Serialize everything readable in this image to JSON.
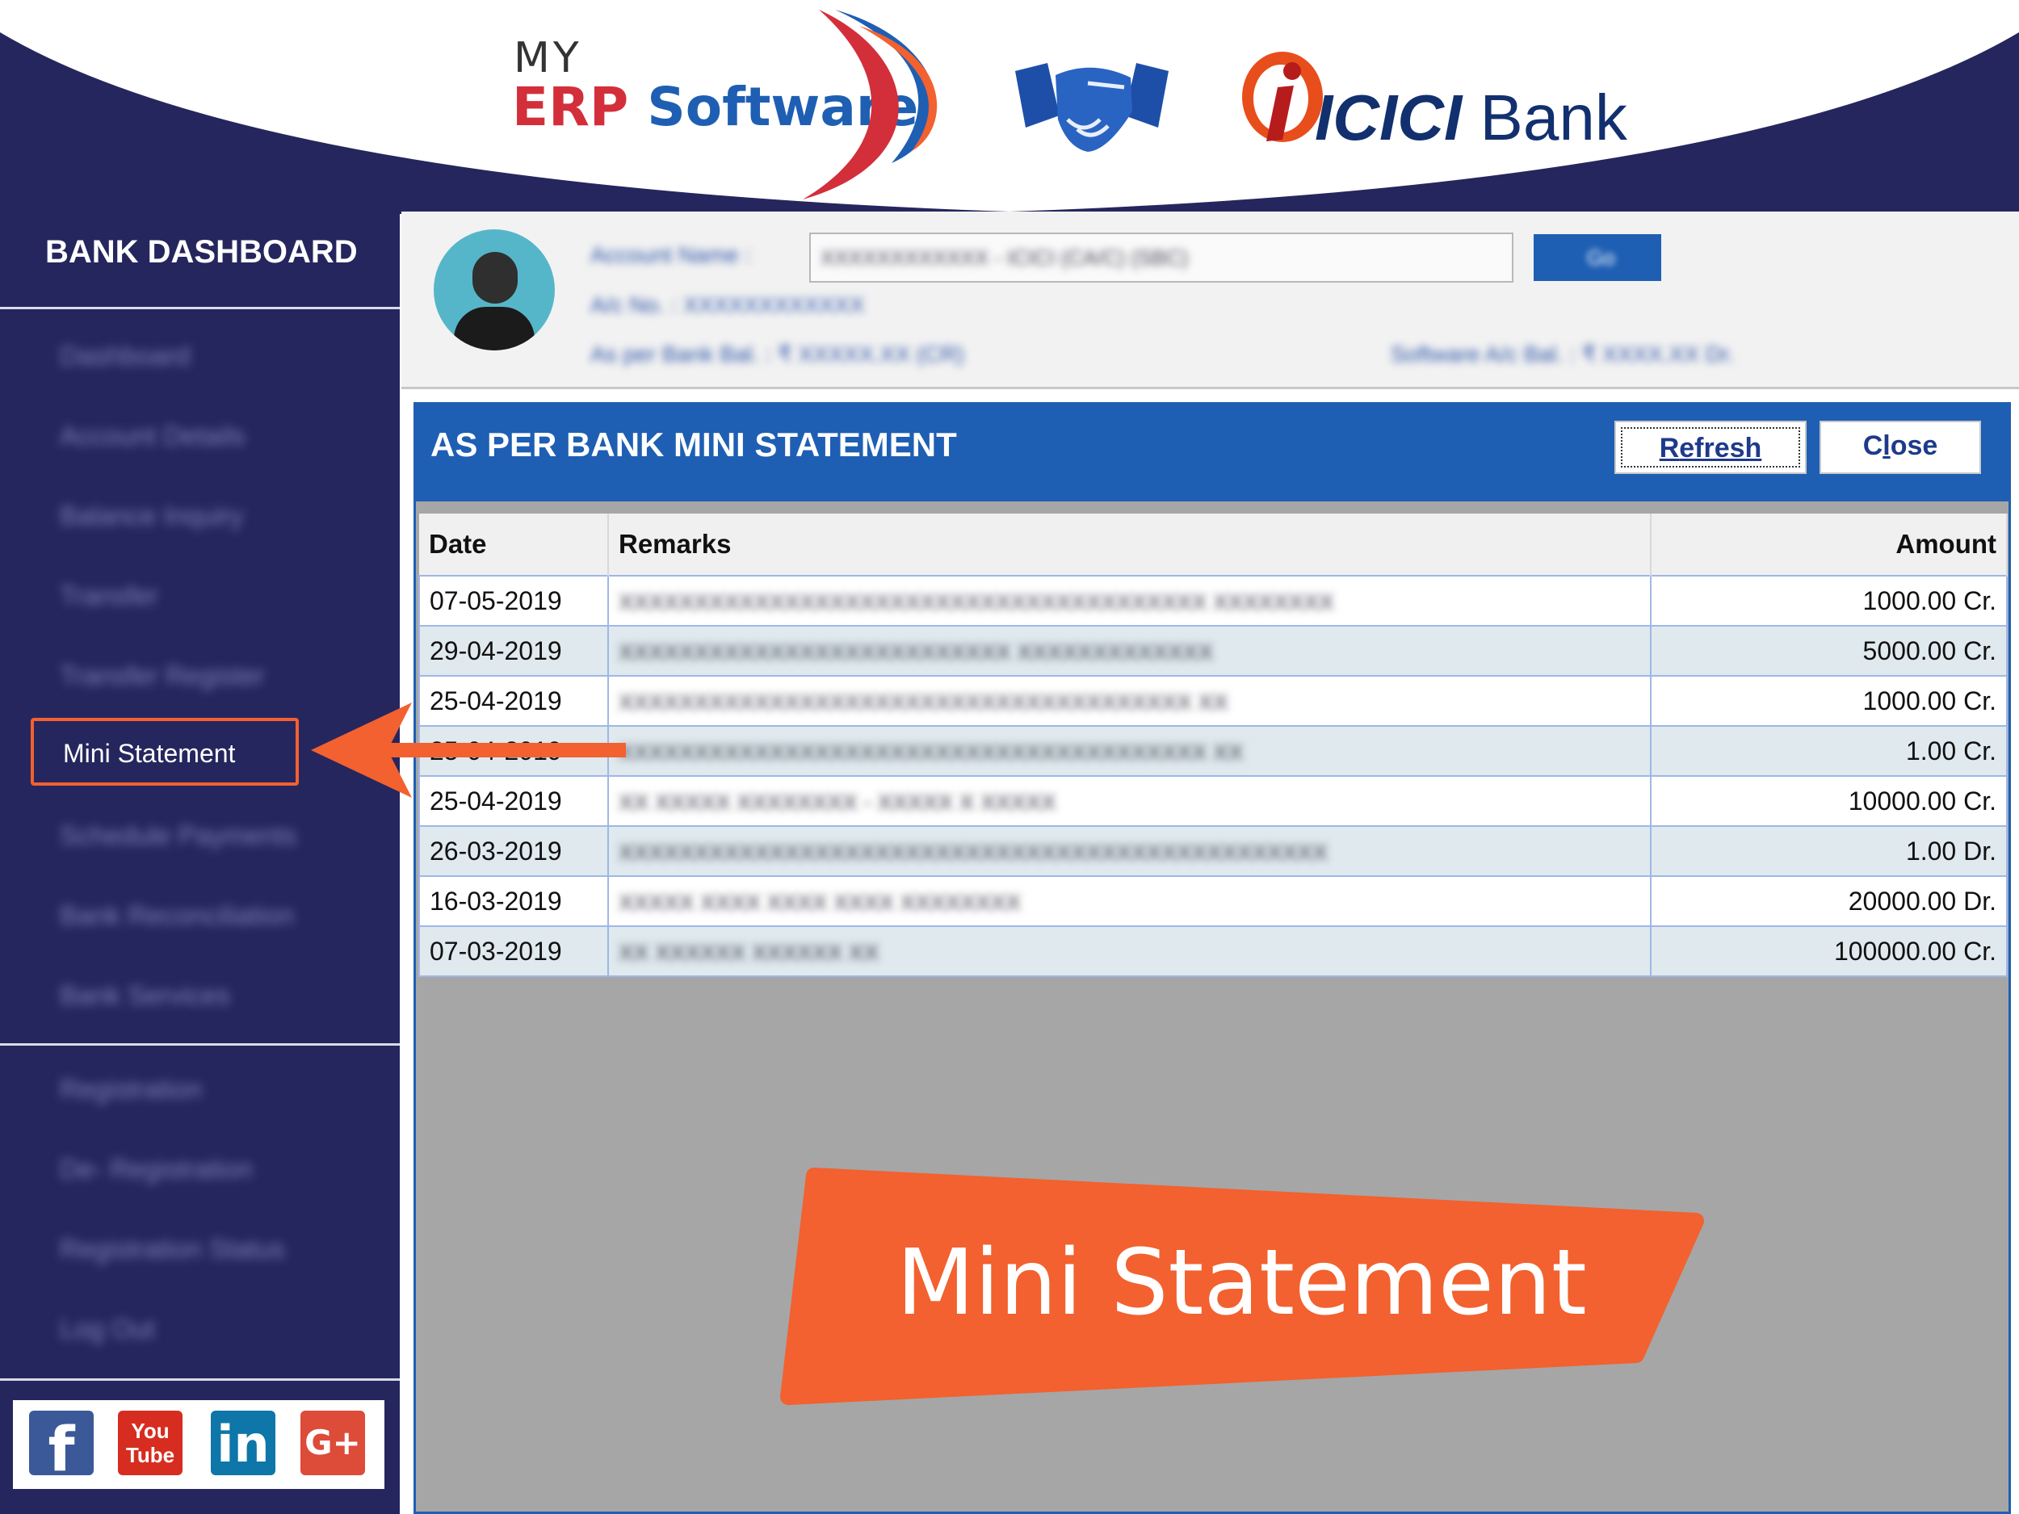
{
  "banner": {
    "erp_logo_my": "MY",
    "erp_logo_erp": "ERP",
    "erp_logo_software": "Software",
    "partner_icon": "handshake-icon",
    "bank_logo_icici": "ICICI",
    "bank_logo_bank": "Bank"
  },
  "sidebar": {
    "title": "BANK DASHBOARD",
    "items": [
      {
        "label": "Dashboard"
      },
      {
        "label": "Account Details"
      },
      {
        "label": "Balance Inquiry"
      },
      {
        "label": "Transfer"
      },
      {
        "label": "Transfer Register"
      },
      {
        "label": "Mini Statement"
      },
      {
        "label": "Schedule Payments"
      },
      {
        "label": "Bank Reconciliation"
      },
      {
        "label": "Bank Services"
      }
    ],
    "items2": [
      {
        "label": "Registration"
      },
      {
        "label": "De- Registration"
      },
      {
        "label": "Registration Status"
      },
      {
        "label": "Log Out"
      }
    ],
    "active_index": 5,
    "social": {
      "facebook": "f",
      "youtube_top": "You",
      "youtube_bottom": "Tube",
      "linkedin": "in",
      "googleplus": "G+"
    }
  },
  "account": {
    "name_label": "Account Name :",
    "selected_account": "XXXXXXXXXXXX - ICICI (CA/C) (SBC)",
    "go_label": "Go",
    "ac_no_label": "A/c No. :",
    "ac_no": "XXXXXXXXXXXX",
    "bank_bal_label": "As per Bank Bal. :",
    "bank_bal": "₹ XXXXX.XX (CR)",
    "software_bal_label": "Software A/c Bal. :",
    "software_bal": "₹ XXXX.XX Dr."
  },
  "statement": {
    "title": "AS PER BANK MINI STATEMENT",
    "refresh_first": "R",
    "refresh_rest": "efresh",
    "close_first": "C",
    "close_u": "l",
    "close_rest": "ose",
    "columns": [
      "Date",
      "Remarks",
      "Amount"
    ],
    "rows": [
      {
        "date": "07-05-2019",
        "remarks": "XXXXXXXXXXXXXXXXXXXXXXXXXXXXXXXXXXXXXXX XXXXXXXX",
        "amount": "1000.00 Cr."
      },
      {
        "date": "29-04-2019",
        "remarks": "XXXXXXXXXXXXXXXXXXXXXXXXXX   XXXXXXXXXXXXX",
        "amount": "5000.00 Cr."
      },
      {
        "date": "25-04-2019",
        "remarks": "XXXXXXXXXXXXXXXXXXXXXXXXXXXXXXXXXXXXXX   XX",
        "amount": "1000.00 Cr."
      },
      {
        "date": "25-04-2019",
        "remarks": "XXXXXXXXXXXXXXXXXXXXXXXXXXXXXXXXXXXXXXX   XX",
        "amount": "1.00 Cr."
      },
      {
        "date": "25-04-2019",
        "remarks": "XX XXXXX XXXXXXXX - XXXXX X XXXXX",
        "amount": "10000.00 Cr."
      },
      {
        "date": "26-03-2019",
        "remarks": "XXXXXXXXXXXXXXXXXXXXXXXXXXXXXXXXXXXXXXXXXXXXXXX",
        "amount": "1.00 Dr."
      },
      {
        "date": "16-03-2019",
        "remarks": "XXXXX XXXX XXXX XXXX XXXXXXXX",
        "amount": "20000.00 Dr."
      },
      {
        "date": "07-03-2019",
        "remarks": "XX XXXXXX XXXXXX    XX",
        "amount": "100000.00 Cr."
      }
    ]
  },
  "callout": {
    "text": "Mini Statement"
  },
  "colors": {
    "sidebar_bg": "#26265e",
    "accent_blue": "#1e5fb3",
    "callout_orange": "#f2612f",
    "row_alt": "#dfe9ee"
  }
}
